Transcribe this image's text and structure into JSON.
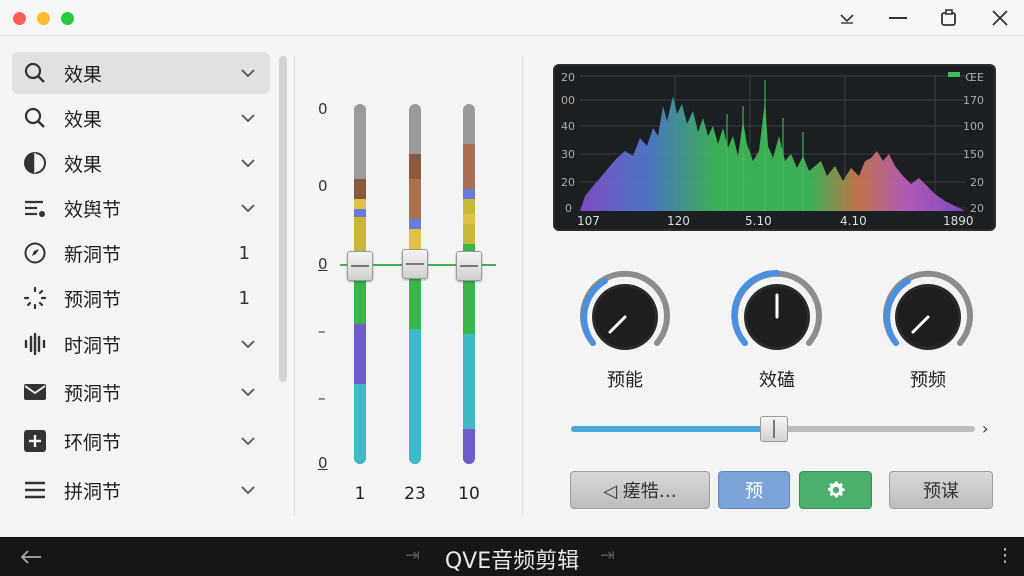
{
  "window": {
    "controls": [
      "chevron-down-icon",
      "minimize-icon",
      "restore-icon",
      "close-icon"
    ]
  },
  "sidebar": {
    "items": [
      {
        "icon": "search-icon",
        "label": "效果",
        "trailing": "chevron",
        "active": true
      },
      {
        "icon": "search-icon",
        "label": "效果",
        "trailing": "chevron"
      },
      {
        "icon": "half-circle-icon",
        "label": "效果",
        "trailing": "chevron"
      },
      {
        "icon": "sliders-icon",
        "label": "效舆节",
        "trailing": "chevron"
      },
      {
        "icon": "compass-icon",
        "label": "新洞节",
        "trailing": "1"
      },
      {
        "icon": "spinner-icon",
        "label": "预洞节",
        "trailing": "1"
      },
      {
        "icon": "waveform-icon",
        "label": "时洞节",
        "trailing": "chevron"
      },
      {
        "icon": "envelope-icon",
        "label": "预洞节",
        "trailing": "chevron"
      },
      {
        "icon": "plus-box-icon",
        "label": "环侗节",
        "trailing": "chevron"
      },
      {
        "icon": "menu-icon",
        "label": "拼洞节",
        "trailing": "chevron"
      }
    ]
  },
  "mixer": {
    "scale": [
      "0",
      "0",
      "0",
      "–",
      "–",
      "0"
    ],
    "faders": [
      {
        "label": "1"
      },
      {
        "label": "23"
      },
      {
        "label": "10"
      }
    ]
  },
  "spectrum": {
    "y_left": [
      "20",
      "00",
      "40",
      "30",
      "20",
      "0"
    ],
    "y_right": [
      "ŒE",
      "170",
      "100",
      "150",
      "20",
      "20"
    ],
    "x_labels": [
      "107",
      "120",
      "5.10",
      "4.10",
      "1890"
    ],
    "colors": {
      "blue": "#4f7fd6",
      "green": "#3fbf5a",
      "purple": "#8a4fd0",
      "orange": "#d07c4a",
      "magenta": "#c060c8"
    }
  },
  "knobs": [
    {
      "label": "预能",
      "level": 0.28
    },
    {
      "label": "效磕",
      "level": 0.5
    },
    {
      "label": "预频",
      "level": 0.28
    }
  ],
  "slider": {
    "value": 0.5
  },
  "buttons": [
    {
      "label": "◁  瘥牿…",
      "style": "gray"
    },
    {
      "label": "预",
      "style": "blue"
    },
    {
      "label": "",
      "icon": "gear-icon",
      "style": "green"
    },
    {
      "label": "预谋",
      "style": "gray"
    }
  ],
  "footer": {
    "title": "QVE音频剪辑"
  }
}
